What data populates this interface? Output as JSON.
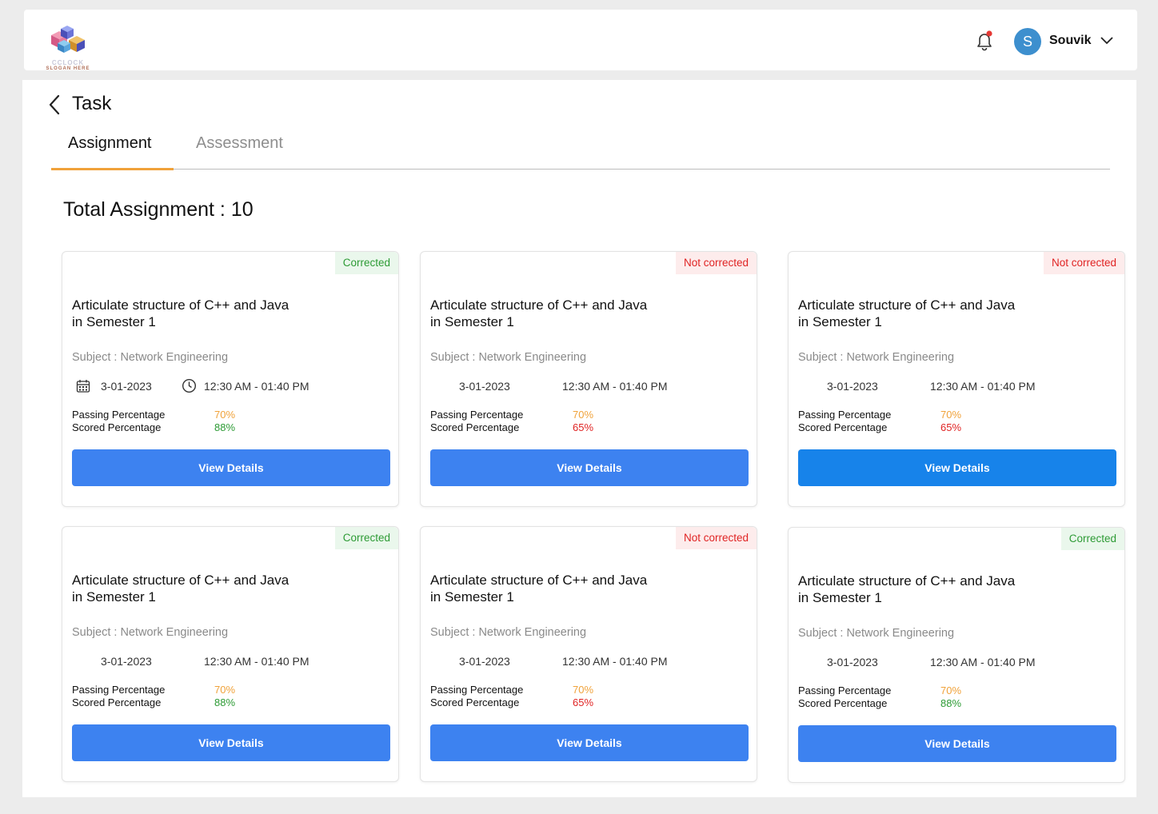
{
  "header": {
    "logo_text": "CCLOCK",
    "logo_slogan": "SLOGAN HERE",
    "user_initial": "S",
    "user_name": "Souvik"
  },
  "page": {
    "title": "Task",
    "tabs": [
      {
        "label": "Assignment",
        "active": true
      },
      {
        "label": "Assessment",
        "active": false
      }
    ],
    "total_label": "Total Assignment : 10"
  },
  "cards": [
    {
      "status": "Corrected",
      "title_line1": "Articulate structure of C++ and Java",
      "title_line2": "in Semester 1",
      "subject": "Subject : Network Engineering",
      "date": "3-01-2023",
      "time": "12:30 AM - 01:40 PM",
      "passing_label": "Passing Percentage",
      "passing_value": "70%",
      "scored_label": "Scored Percentage",
      "scored_value": "88%",
      "button": "View Details"
    },
    {
      "status": "Not corrected",
      "title_line1": "Articulate structure of C++ and Java",
      "title_line2": "in Semester 1",
      "subject": "Subject : Network Engineering",
      "date": "3-01-2023",
      "time": "12:30 AM - 01:40 PM",
      "passing_label": "Passing Percentage",
      "passing_value": "70%",
      "scored_label": "Scored Percentage",
      "scored_value": "65%",
      "button": "View Details"
    },
    {
      "status": "Not corrected",
      "title_line1": "Articulate structure of C++ and Java",
      "title_line2": "in Semester 1",
      "subject": "Subject : Network Engineering",
      "date": "3-01-2023",
      "time": "12:30 AM - 01:40 PM",
      "passing_label": "Passing Percentage",
      "passing_value": "70%",
      "scored_label": "Scored Percentage",
      "scored_value": "65%",
      "button": "View Details"
    },
    {
      "status": "Corrected",
      "title_line1": "Articulate structure of C++ and Java",
      "title_line2": "in Semester 1",
      "subject": "Subject : Network Engineering",
      "date": "3-01-2023",
      "time": "12:30 AM - 01:40 PM",
      "passing_label": "Passing Percentage",
      "passing_value": "70%",
      "scored_label": "Scored Percentage",
      "scored_value": "88%",
      "button": "View Details"
    },
    {
      "status": "Not corrected",
      "title_line1": "Articulate structure of C++ and Java",
      "title_line2": "in Semester 1",
      "subject": "Subject : Network Engineering",
      "date": "3-01-2023",
      "time": "12:30 AM - 01:40 PM",
      "passing_label": "Passing Percentage",
      "passing_value": "70%",
      "scored_label": "Scored Percentage",
      "scored_value": "65%",
      "button": "View Details"
    },
    {
      "status": "Corrected",
      "title_line1": "Articulate structure of C++ and Java",
      "title_line2": "in Semester 1",
      "subject": "Subject : Network Engineering",
      "date": "3-01-2023",
      "time": "12:30 AM - 01:40 PM",
      "passing_label": "Passing Percentage",
      "passing_value": "70%",
      "scored_label": "Scored Percentage",
      "scored_value": "88%",
      "button": "View Details"
    }
  ],
  "colors": {
    "accent_blue": "#3d82f0",
    "tab_underline": "#f0a23a",
    "corrected": "#2d9b35",
    "not_corrected": "#e02424",
    "avatar": "#3d8fce"
  },
  "icons": {
    "notification": "bell-icon",
    "back": "chevron-left-icon",
    "menu": "chevron-down-icon",
    "date": "calendar-icon",
    "time": "clock-icon"
  }
}
